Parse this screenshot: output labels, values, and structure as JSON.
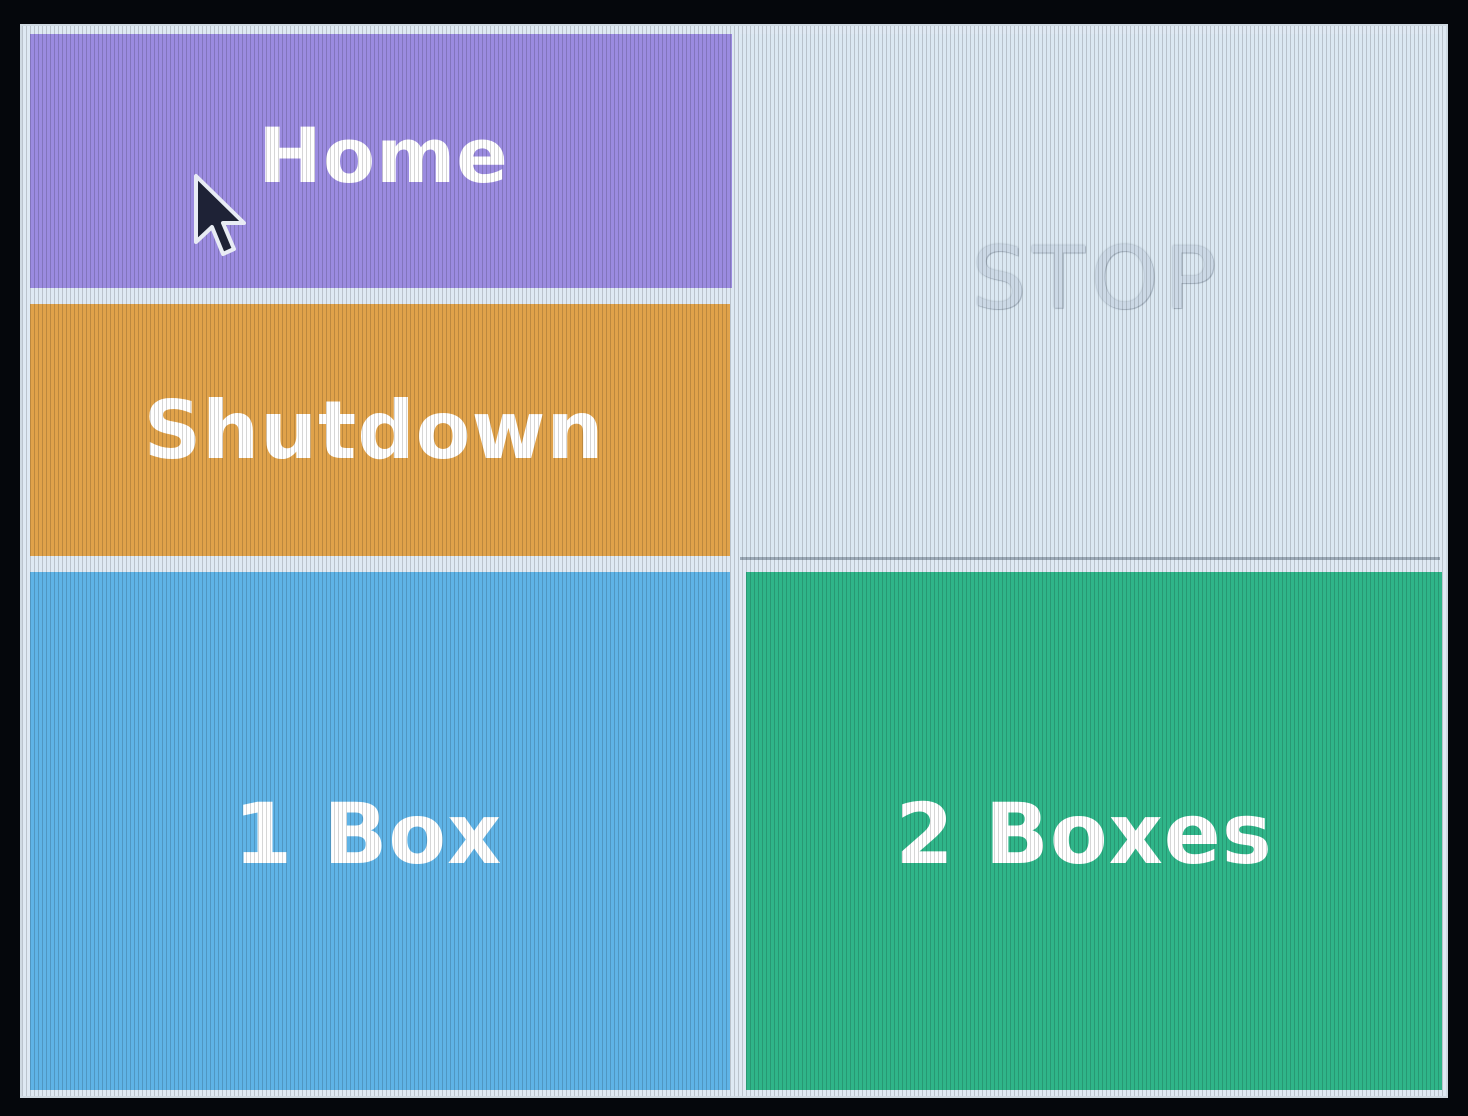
{
  "buttons": {
    "home": {
      "label": "Home",
      "color": "#9b8be0"
    },
    "shutdown": {
      "label": "Shutdown",
      "color": "#e0a24a"
    },
    "stop": {
      "label": "STOP",
      "color": "#dbe8f2",
      "state": "disabled"
    },
    "one_box": {
      "label": "1 Box",
      "color": "#5fb3e6"
    },
    "two_boxes": {
      "label": "2 Boxes",
      "color": "#2fb589"
    }
  },
  "cursor": {
    "icon": "mouse-pointer-icon"
  }
}
